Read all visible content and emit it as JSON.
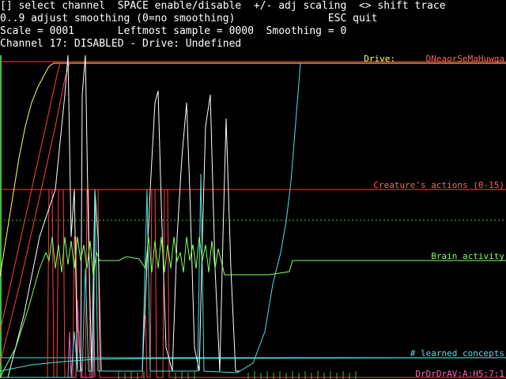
{
  "header": {
    "line1": "[] select channel  SPACE enable/disable  +/- adj scaling  <> shift trace",
    "line2": "0..9 adjust smoothing (0=no smoothing)               ESC quit",
    "status": "Scale = 0001       Leftmost sample = 0000  Smoothing = 0",
    "channel": "Channel 17: DISABLED - Drive: Undefined"
  },
  "labels": {
    "drive": "Drive:",
    "drive_overlap": "DNeaorSeMaHuwga",
    "creature_actions": "Creature's actions (0-15)",
    "brain_activity": "Brain activity",
    "learned_concepts": "# learned concepts",
    "bottom_overlap": "DrDrDrAV:A:H5:7:1"
  },
  "colors": {
    "background": "#000000",
    "header_text": "#ffffff",
    "actions": "#ff4040",
    "brain": "#80ff60",
    "concepts": "#50e0e0",
    "drive": "#ffff60",
    "white_trace": "#ffffff",
    "pink": "#ff60c0",
    "dotted": "#40c040"
  }
}
